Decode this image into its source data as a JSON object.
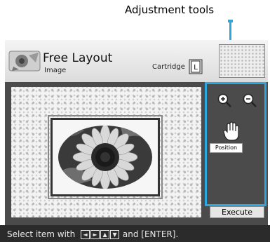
{
  "callout": {
    "label": "Adjustment tools"
  },
  "header": {
    "title": "Free Layout",
    "subtitle": "Image",
    "cartridge_label": "Cartridge",
    "cartridge_size": "L"
  },
  "tools": {
    "position_label": "Position",
    "execute_label": "Execute"
  },
  "status": {
    "prefix": "Select item with",
    "suffix": "and [ENTER]."
  },
  "colors": {
    "accent": "#2aa6e0",
    "main_background": "#4b4b4b",
    "status_background": "#2b2b2b"
  }
}
